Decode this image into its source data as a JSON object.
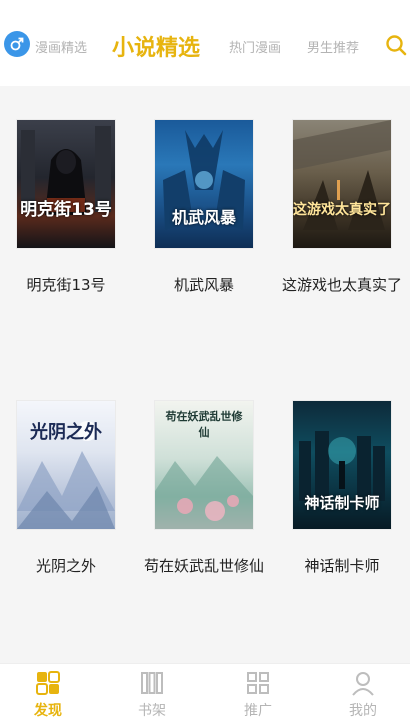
{
  "header": {
    "tabs": [
      {
        "label": "漫画精选",
        "active": false
      },
      {
        "label": "小说精选",
        "active": true
      },
      {
        "label": "热门漫画",
        "active": false
      },
      {
        "label": "男生推荐",
        "active": false
      }
    ],
    "left_icon": "gender-male-icon",
    "right_icon": "search-icon"
  },
  "books": [
    {
      "title": "明克街13号",
      "cover_text": "明克街13号"
    },
    {
      "title": "机武风暴",
      "cover_text": "机武风暴"
    },
    {
      "title": "这游戏也太真实了",
      "cover_text": "这游戏太真实了"
    },
    {
      "title": "光阴之外",
      "cover_text": "光阴之外"
    },
    {
      "title": "苟在妖武乱世修仙",
      "cover_text": "苟在妖武乱世修仙"
    },
    {
      "title": "神话制卡师",
      "cover_text": "神话制卡师"
    }
  ],
  "bottom_nav": [
    {
      "label": "发现",
      "icon": "discover-icon",
      "active": true
    },
    {
      "label": "书架",
      "icon": "bookshelf-icon",
      "active": false
    },
    {
      "label": "推广",
      "icon": "promote-grid-icon",
      "active": false
    },
    {
      "label": "我的",
      "icon": "profile-icon",
      "active": false
    }
  ],
  "colors": {
    "accent": "#e7b40f",
    "inactive": "#b3b3b3",
    "brand_blue": "#3b96e8",
    "content_bg": "#f5f5f5"
  }
}
